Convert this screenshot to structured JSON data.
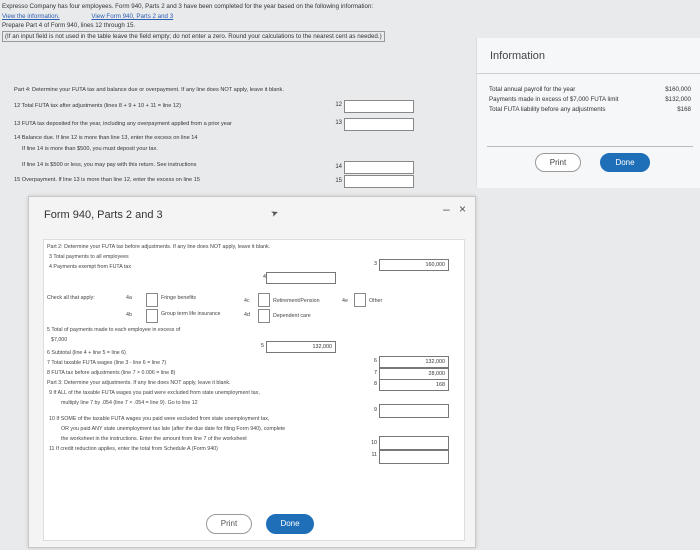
{
  "intro": {
    "line1": "Expresso Company has four employees. Form 940, Parts 2 and 3 have been completed for the year based on the following information:",
    "link1": "View the information.",
    "link2": "View Form 940, Parts 2 and 3",
    "line3": "Prepare Part 4 of Form 940, lines 12 through 15.",
    "line4": "(If an input field is not used in the table leave the field empty; do not enter a zero. Round your calculations to the nearest cent as needed.)"
  },
  "part4": {
    "header": "Part 4: Determine your FUTA tax and balance due or overpayment. If any line does NOT apply, leave it blank.",
    "l12": "12 Total FUTA tax after adjustments (lines 8 + 9 + 10 + 11 = line 12)",
    "l13": "13 FUTA tax deposited for the year, including any overpayment applied from a prior year",
    "l14a": "14 Balance due. If line 12 is more than line 13, enter the excess on line 14",
    "l14b": "If line 14 is more than $500, you must deposit your tax.",
    "l14c": "If line 14 is $500 or less, you may pay with this return. See instructions",
    "l15": "15 Overpayment. If line 13 is more than line 12, enter the excess on line 15",
    "n12": "12",
    "n13": "13",
    "n14": "14",
    "n15": "15"
  },
  "info": {
    "title": "Information",
    "rows": [
      {
        "label": "Total annual payroll for the year",
        "value": "$160,000"
      },
      {
        "label": "Payments made in excess of $7,000 FUTA limit",
        "value": "$132,000"
      },
      {
        "label": "Total FUTA liability before any adjustments",
        "value": "$168"
      }
    ],
    "print": "Print",
    "done": "Done"
  },
  "modal": {
    "title": "Form 940, Parts 2 and 3",
    "minimize": "–",
    "close": "×",
    "part2_header": "Part 2: Determine your FUTA tax before adjustments. If any line does NOT apply, leave it blank.",
    "l3": "3 Total payments to all employees",
    "l4": "4 Payments exempt from FUTA tax",
    "check_all": "Check all that apply:",
    "c4a": "4a",
    "c4b": "4b",
    "c4c": "4c",
    "c4d": "4d",
    "c4e": "4e",
    "fringe": "Fringe benefits",
    "group": "Group term life insurance",
    "retire1": "Retirement/Pension",
    "retire2": "Dependent care",
    "other": "Other",
    "l5a": "5 Total of payments made to each employee in excess of",
    "l5b": "$7,000",
    "l6": "6 Subtotal (line 4 + line 5 = line 6)",
    "l7": "7 Total taxable FUTA wages (line 3 - line 6 = line 7)",
    "l8": "8 FUTA tax before adjustments (line 7 × 0.006 = line 8)",
    "part3_header": "Part 3: Determine your adjustments. If any line does NOT apply, leave it blank.",
    "l9a": "9 If ALL of the taxable FUTA wages you paid were excluded from state unemployment tax,",
    "l9b": "multiply line 7 by .054 (line 7 × .054 = line 9). Go to line 12",
    "l10a": "10 If SOME of the taxable FUTA wages you paid were excluded from state unemployment tax,",
    "l10b": "OR you paid ANY state unemployment tax late (after the due date for filing Form 940), complete",
    "l10c": "the worksheet in the instructions. Enter the amount from line 7 of the worksheet",
    "l11": "11 If credit reduction applies, enter the total from Schedule A (Form 940)",
    "n3": "3",
    "n4": "4",
    "n5": "5",
    "n6": "6",
    "n7": "7",
    "n8": "8",
    "n9": "9",
    "n10": "10",
    "n11": "11",
    "v3": "160,000",
    "v5": "132,000",
    "v6": "132,000",
    "v7": "28,000",
    "v8": "168",
    "print": "Print",
    "done": "Done"
  }
}
